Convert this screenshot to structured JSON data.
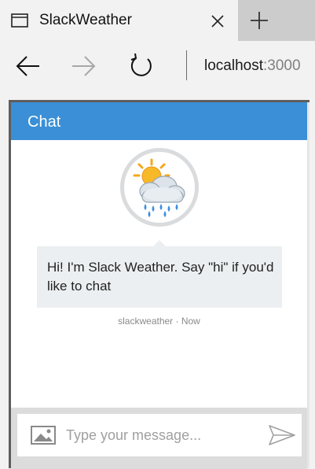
{
  "browser": {
    "tab_title": "SlackWeather",
    "address_host": "localhost",
    "address_port": ":3000"
  },
  "chat": {
    "header_title": "Chat",
    "avatar_icon": "weather-rain-cloud-sun-icon",
    "message_text": "Hi! I'm Slack Weather. Say \"hi\" if you'd like to chat",
    "timestamp": "slackweather · Now",
    "input_placeholder": "Type your message..."
  },
  "colors": {
    "header_blue": "#3a8fd6",
    "bubble_bg": "#eceff1"
  }
}
